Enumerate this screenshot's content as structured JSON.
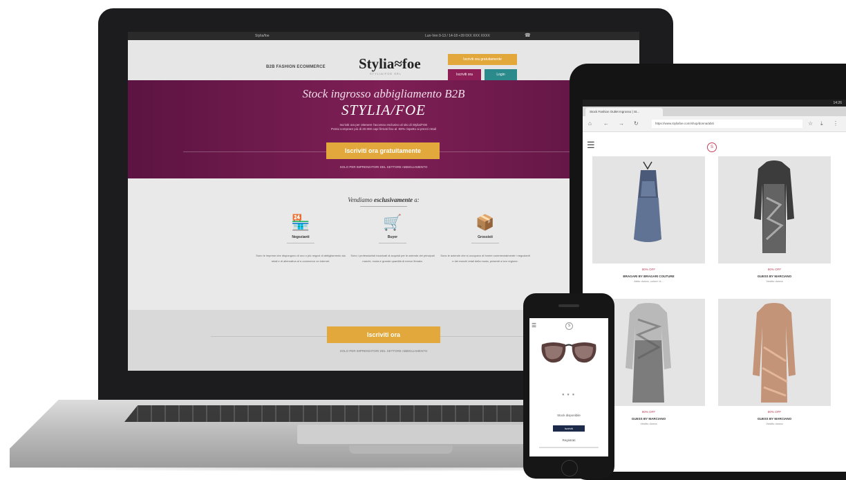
{
  "laptop": {
    "topbar": {
      "left": "Stylia/foe",
      "right": "Lun-Ven 9-13 / 14-18   +39 0XX XXX XXXX"
    },
    "header": {
      "tagline": "B2B FASHION ECOMMERCE",
      "logo": "Stylia≈foe",
      "logo_sub": "STYLIA/FOE SRL",
      "btn_primary": "Iscriviti ora gratuitamente",
      "btn_login": "Iscriviti ora",
      "btn_account": "Login"
    },
    "hero": {
      "title": "Stock ingrosso abbigliamento B2B",
      "subtitle": "STYLIA/FOE",
      "text1": "Iscriviti ora per ottenere l'accesso esclusivo al sito di Stylia/FOE",
      "text2": "Potrai comprare più di 20.000 capi firmati fino al -80% rispetto ai prezzi retail",
      "cta": "Iscriviti ora gratuitamente",
      "note": "SOLO PER IMPRENDITORI DEL SETTORE ABBIGLIAMENTO"
    },
    "vendiamo": {
      "title_plain": "Vendiamo",
      "title_em": "esclusivamente",
      "title_tail": "a:",
      "features": [
        {
          "icon": "shop-icon",
          "glyph": "🏪",
          "label": "Negozianti",
          "text": "Sono le imprese che dispongono di uno o più negozi di abbigliamento sia retail e di alternativa al e-commerce on internet."
        },
        {
          "icon": "cart-icon",
          "glyph": "🛒",
          "label": "Buyer",
          "text": "Sono i professionisti incaricati di acquisti per le aziende dei principali marchi, moda e grande quantità di merce firmata."
        },
        {
          "icon": "box-icon",
          "glyph": "📦",
          "label": "Grossisti",
          "text": "Sono le aziende che si occupano di fornire commercialmente i negozianti e dei marchi retail della moda, presenti a loro regione."
        }
      ]
    },
    "bottom": {
      "cta": "Iscriviti ora",
      "note": "SOLO PER IMPRENDITORI DEL SETTORE ABBIGLIAMENTO"
    }
  },
  "tablet": {
    "status_time": "14:26",
    "tab_title": "Stock Fashion Outlet Ingrosso | St...",
    "url": "https://www.styliafoe.com/shop/donna/abiti",
    "products": [
      {
        "discount": "80% OFF",
        "name": "BRAGARI BY BRAGARI COUTURE",
        "sub": "Abito donna, colore: A..."
      },
      {
        "discount": "80% OFF",
        "name": "GUESS BY MARCIANO",
        "sub": "Vestito donna"
      },
      {
        "discount": "80% OFF",
        "name": "GUESS BY MARCIANO",
        "sub": "Vestito donna"
      },
      {
        "discount": "80% OFF",
        "name": "GUESS BY MARCIANO",
        "sub": "Vestito donna"
      }
    ]
  },
  "phone": {
    "dots": "● ● ●",
    "stock_label": "Stock disponibile",
    "btn": "Iscriviti",
    "register_label": "Registrati"
  },
  "colors": {
    "plum": "#7e1f55",
    "gold": "#e2a83b",
    "teal": "#2a8a8c",
    "navy": "#1d2a4a"
  }
}
